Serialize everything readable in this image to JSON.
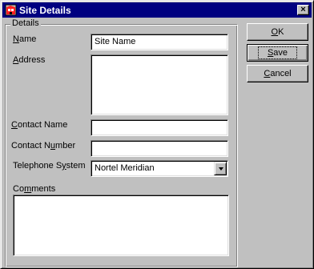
{
  "window": {
    "title": "Site Details",
    "close_glyph": "×",
    "icon": "app-icon"
  },
  "details_group": {
    "legend": "Details"
  },
  "form": {
    "name": {
      "label_mn": "N",
      "label_rest": "ame",
      "value": "Site Name"
    },
    "address": {
      "label_mn": "A",
      "label_rest": "ddress",
      "value": ""
    },
    "contact_name": {
      "label_mn": "C",
      "label_rest": "ontact Name",
      "value": ""
    },
    "contact_number": {
      "label_pre": "Contact N",
      "label_mn": "u",
      "label_rest": "mber",
      "value": ""
    },
    "telephone_system": {
      "label_pre": "Telephone S",
      "label_mn": "y",
      "label_rest": "stem",
      "value": "Nortel Meridian"
    },
    "comments": {
      "label_pre": "Co",
      "label_mn": "m",
      "label_rest": "ments",
      "value": ""
    }
  },
  "buttons": {
    "ok": {
      "mn": "O",
      "rest": "K"
    },
    "save": {
      "mn": "S",
      "rest": "ave"
    },
    "cancel": {
      "mn": "C",
      "rest": "ancel"
    }
  }
}
